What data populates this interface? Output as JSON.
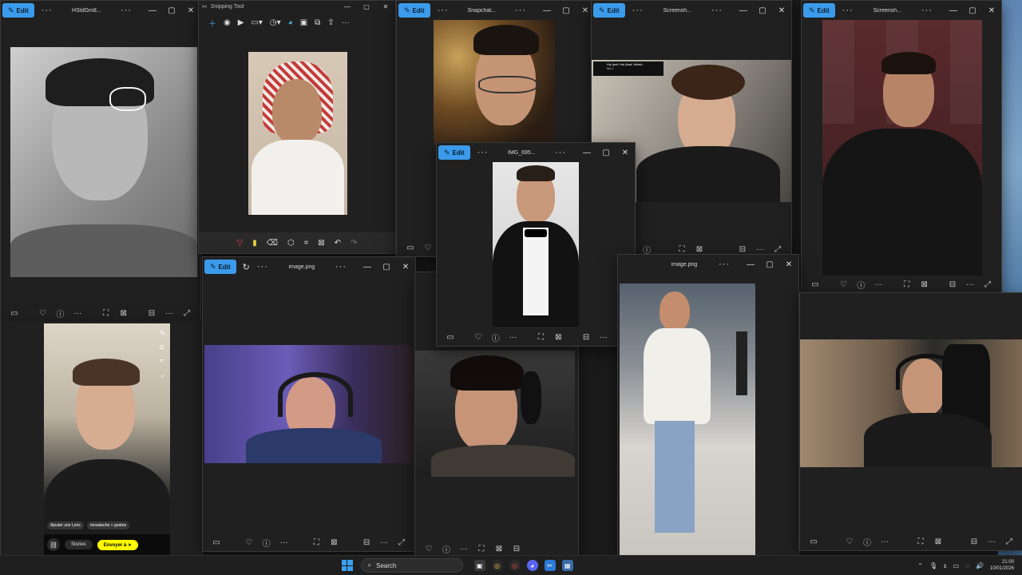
{
  "windows": {
    "w1": {
      "edit": "Edit",
      "title": "HStdGm8..."
    },
    "w2": {
      "title": "Snipping Tool"
    },
    "w3": {
      "edit": "Edit",
      "title": "Snapchat..."
    },
    "w4": {
      "edit": "Edit",
      "title": "Screensh..."
    },
    "w5": {
      "edit": "Edit",
      "title": "Screensh..."
    },
    "w6": {
      "edit": "Edit",
      "title": "IMG_695..."
    },
    "w7": {
      "edit": "Edit",
      "title": "image.png"
    },
    "w8": {
      "title": "image.png"
    }
  },
  "music_overlay": {
    "line1": "Hiç İpek Yok (feat. Melek...",
    "line2": "No.1"
  },
  "snapchat": {
    "chip1": "Ajouter une Lens",
    "chip2": "moustache + goatee",
    "stories": "Stories",
    "send": "Envoyer à"
  },
  "taskbar": {
    "search_placeholder": "Search",
    "time": "21:00",
    "date": "10/01/2026"
  },
  "colors": {
    "accent": "#3b9bea",
    "snap_yellow": "#fffc00"
  }
}
